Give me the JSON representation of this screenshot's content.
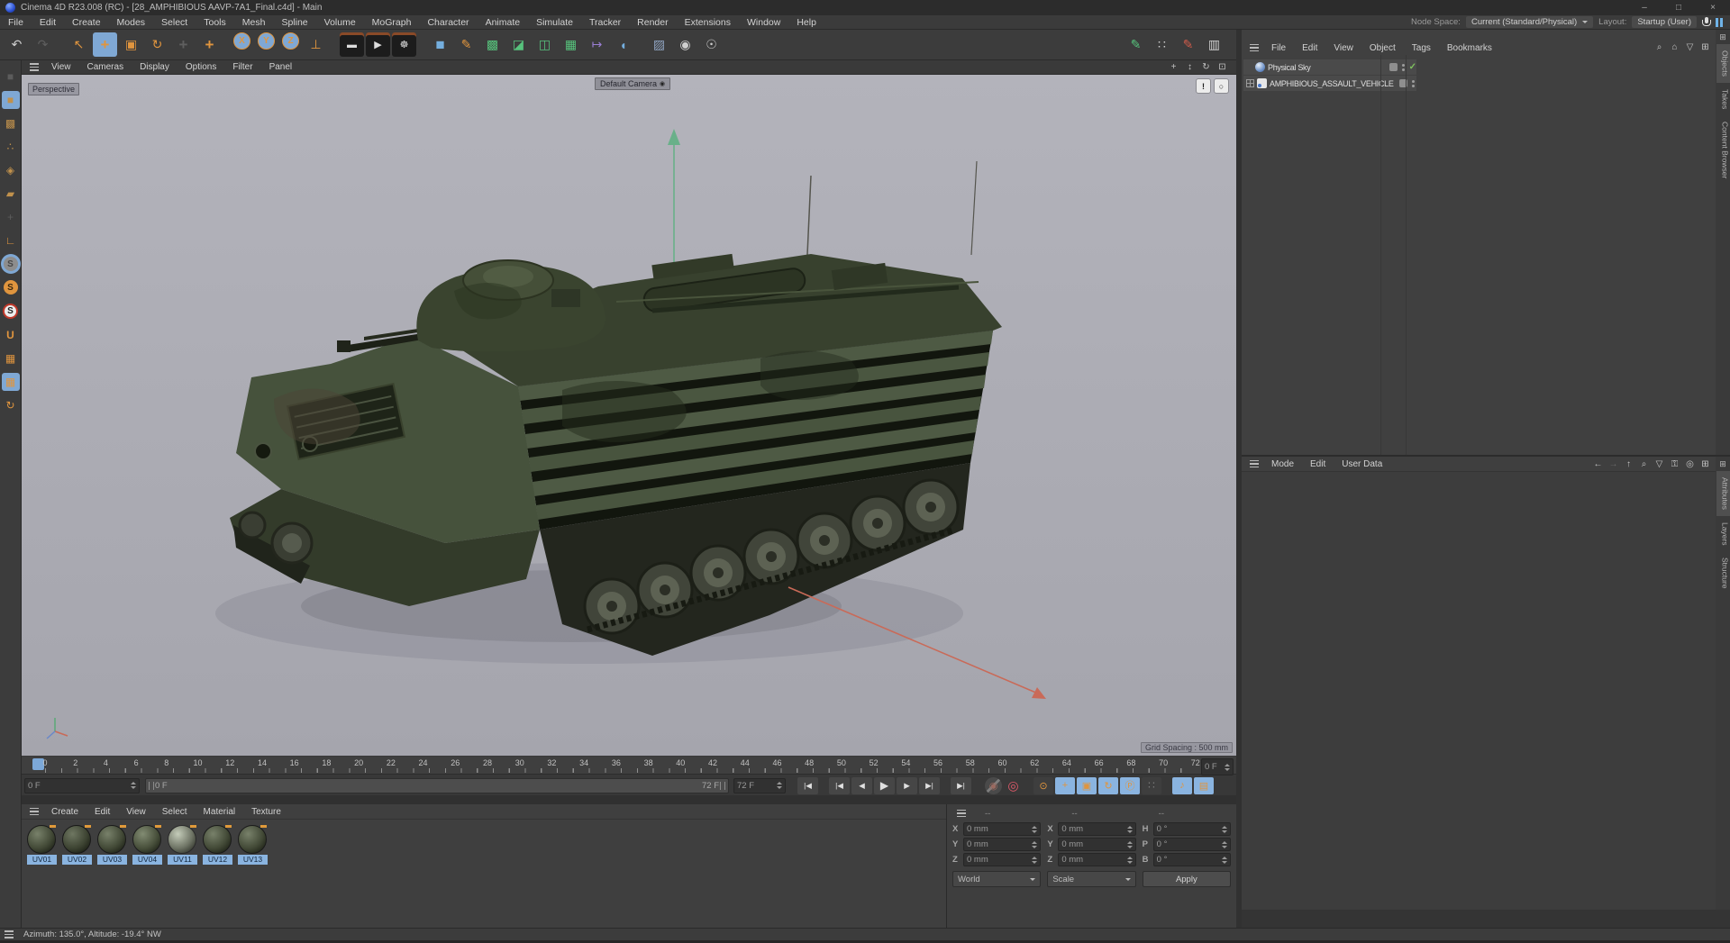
{
  "window": {
    "title": "Cinema 4D R23.008 (RC) - [28_AMPHIBIOUS AAVP-7A1_Final.c4d] - Main",
    "minimize": "–",
    "maximize": "□",
    "close": "×"
  },
  "menubar": {
    "items": [
      "File",
      "Edit",
      "Create",
      "Modes",
      "Select",
      "Tools",
      "Mesh",
      "Spline",
      "Volume",
      "MoGraph",
      "Character",
      "Animate",
      "Simulate",
      "Tracker",
      "Render",
      "Extensions",
      "Window",
      "Help"
    ],
    "node_space_label": "Node Space:",
    "node_space_value": "Current (Standard/Physical)",
    "layout_label": "Layout:",
    "layout_value": "Startup (User)"
  },
  "toolbar": {
    "main": [
      {
        "name": "undo-icon",
        "glyph": "↶",
        "cls": "light"
      },
      {
        "name": "redo-icon",
        "glyph": "↷",
        "cls": "dim"
      },
      {
        "name": "live-selection-icon",
        "glyph": "↖",
        "cls": "orange gap"
      },
      {
        "name": "move-tool-icon",
        "glyph": "+",
        "cls": "orange big active"
      },
      {
        "name": "scale-tool-icon",
        "glyph": "▣",
        "cls": "orange"
      },
      {
        "name": "rotate-tool-icon",
        "glyph": "↻",
        "cls": "orange"
      },
      {
        "name": "last-tool-icon",
        "glyph": "+",
        "cls": "dim big"
      },
      {
        "name": "tweak-move-icon",
        "glyph": "+",
        "cls": "orange big"
      },
      {
        "name": "lock-x-axis-icon",
        "glyph": "X",
        "cls": "axis active gap"
      },
      {
        "name": "lock-y-axis-icon",
        "glyph": "Y",
        "cls": "axis active"
      },
      {
        "name": "lock-z-axis-icon",
        "glyph": "Z",
        "cls": "axis active"
      },
      {
        "name": "coordinate-system-icon",
        "glyph": "⊥",
        "cls": "orange"
      },
      {
        "name": "render-view-icon",
        "glyph": "▬",
        "cls": "clap gap"
      },
      {
        "name": "render-picture-viewer-icon",
        "glyph": "▶",
        "cls": "clap"
      },
      {
        "name": "render-settings-icon",
        "glyph": "☸",
        "cls": "clap"
      },
      {
        "name": "primitive-cube-icon",
        "glyph": "■",
        "cls": "blue gap big"
      },
      {
        "name": "spline-pen-icon",
        "glyph": "✎",
        "cls": "orange"
      },
      {
        "name": "subdivision-surface-icon",
        "glyph": "▩",
        "cls": "green"
      },
      {
        "name": "boole-icon",
        "glyph": "◪",
        "cls": "green"
      },
      {
        "name": "symmetry-icon",
        "glyph": "◫",
        "cls": "green"
      },
      {
        "name": "array-icon",
        "glyph": "▦",
        "cls": "green"
      },
      {
        "name": "instance-icon",
        "glyph": "↦",
        "cls": "purple"
      },
      {
        "name": "volume-icon",
        "glyph": "◖",
        "cls": "blue"
      },
      {
        "name": "floor-icon",
        "glyph": "▨",
        "cls": "slate gap"
      },
      {
        "name": "camera-icon",
        "glyph": "◉",
        "cls": "light"
      },
      {
        "name": "light-icon",
        "glyph": "☉",
        "cls": "light"
      }
    ],
    "extra": [
      {
        "name": "paint-brush-icon",
        "glyph": "✎",
        "cls": "green"
      },
      {
        "name": "dot-grid-icon",
        "glyph": "∷",
        "cls": "light"
      },
      {
        "name": "red-pencil-icon",
        "glyph": "✎",
        "cls": "red"
      },
      {
        "name": "levels-icon",
        "glyph": "▥",
        "cls": "light"
      }
    ]
  },
  "left_toolbar": {
    "icons": [
      {
        "name": "make-editable-icon",
        "glyph": "■",
        "cls": "dim"
      },
      {
        "name": "model-mode-icon",
        "glyph": "■",
        "cls": "cube active"
      },
      {
        "name": "texture-mode-icon",
        "glyph": "▩",
        "cls": "cube"
      },
      {
        "name": "point-mode-icon",
        "glyph": "∴",
        "cls": "cube"
      },
      {
        "name": "edge-mode-icon",
        "glyph": "◈",
        "cls": "cube"
      },
      {
        "name": "polygon-mode-icon",
        "glyph": "▰",
        "cls": "cube"
      },
      {
        "name": "tweak-mode-icon",
        "glyph": "+",
        "cls": "dim"
      },
      {
        "name": "enable-axis-icon",
        "glyph": "∟",
        "cls": "orange bold"
      },
      {
        "name": "solo-off-icon",
        "glyph": "S",
        "cls": "solo gray active"
      },
      {
        "name": "solo-single-icon",
        "glyph": "S",
        "cls": "solo amber"
      },
      {
        "name": "solo-hierarchy-icon",
        "glyph": "S",
        "cls": "solo ring"
      },
      {
        "name": "snap-icon",
        "glyph": "U",
        "cls": "orange bold"
      },
      {
        "name": "workplane-icon",
        "glyph": "▦",
        "cls": "orange"
      },
      {
        "name": "lock-workplane-icon",
        "glyph": "▦",
        "cls": "orange active"
      },
      {
        "name": "workplane-rotate-icon",
        "glyph": "↻",
        "cls": "orange"
      }
    ]
  },
  "viewport": {
    "menu": [
      "View",
      "Cameras",
      "Display",
      "Options",
      "Filter",
      "Panel"
    ],
    "nav_icons": [
      {
        "name": "pan-view-icon",
        "glyph": "+"
      },
      {
        "name": "dolly-view-icon",
        "glyph": "↕"
      },
      {
        "name": "orbit-view-icon",
        "glyph": "↻"
      },
      {
        "name": "toggle-panel-icon",
        "glyph": "⊡"
      }
    ],
    "hud_icons": [
      {
        "name": "viewport-mic-icon",
        "glyph": "!"
      },
      {
        "name": "viewport-ring-icon",
        "glyph": "○"
      }
    ],
    "view_label": "Perspective",
    "camera_label": "Default Camera",
    "grid_spacing": "Grid Spacing : 500 mm"
  },
  "object_manager": {
    "menu": [
      "File",
      "Edit",
      "View",
      "Object",
      "Tags",
      "Bookmarks"
    ],
    "actions": [
      {
        "name": "om-search-icon",
        "glyph": "⌕"
      },
      {
        "name": "om-home-icon",
        "glyph": "⌂"
      },
      {
        "name": "om-filter-icon",
        "glyph": "▽"
      },
      {
        "name": "om-add-icon",
        "glyph": "⊞"
      }
    ],
    "tabs": [
      "Objects",
      "Takes",
      "Content Browser"
    ],
    "rows": [
      {
        "name": "Physical Sky"
      },
      {
        "name": "AMPHIBIOUS_ASSAULT_VEHICLE"
      }
    ]
  },
  "attribute_manager": {
    "menu": [
      "Mode",
      "Edit",
      "User Data"
    ],
    "actions": [
      {
        "name": "am-back-icon",
        "glyph": "←"
      },
      {
        "name": "am-forward-icon",
        "glyph": "→",
        "cls": "dim"
      },
      {
        "name": "am-up-icon",
        "glyph": "↑"
      },
      {
        "name": "am-search-icon",
        "glyph": "⌕"
      },
      {
        "name": "am-filter-icon",
        "glyph": "▽"
      },
      {
        "name": "am-lock-icon",
        "glyph": "⚿"
      },
      {
        "name": "am-target-icon",
        "glyph": "◎"
      },
      {
        "name": "am-add-icon",
        "glyph": "⊞"
      }
    ],
    "tabs": [
      "Attributes",
      "Layers",
      "Structure"
    ]
  },
  "timeline": {
    "ticks": [
      "0",
      "2",
      "4",
      "6",
      "8",
      "10",
      "12",
      "14",
      "16",
      "18",
      "20",
      "22",
      "24",
      "26",
      "28",
      "30",
      "32",
      "34",
      "36",
      "38",
      "40",
      "42",
      "44",
      "46",
      "48",
      "50",
      "52",
      "54",
      "56",
      "58",
      "60",
      "62",
      "64",
      "66",
      "68",
      "70",
      "72"
    ],
    "current_frame": "0 F",
    "start_frame": "0 F",
    "range_start": "0 F",
    "range_end": "72 F",
    "end_frame": "72 F",
    "transport": [
      {
        "name": "goto-start-button",
        "glyph": "|◀"
      },
      {
        "name": "previous-key-button",
        "glyph": "|◀",
        "cls": "gapL"
      },
      {
        "name": "previous-frame-button",
        "glyph": "◀"
      },
      {
        "name": "play-button",
        "glyph": "▶",
        "cls": "play"
      },
      {
        "name": "next-frame-button",
        "glyph": "▶"
      },
      {
        "name": "next-key-button",
        "glyph": "▶|"
      },
      {
        "name": "goto-end-button",
        "glyph": "▶|",
        "cls": "gapL"
      }
    ],
    "record": [
      {
        "name": "record-keyframe-button",
        "glyph": "◉",
        "cls": "recoff"
      },
      {
        "name": "autokey-button",
        "glyph": "◎",
        "cls": "rec"
      }
    ],
    "key_toggles": [
      {
        "name": "keyframe-selection-icon",
        "glyph": "⊙"
      },
      {
        "name": "key-position-toggle",
        "glyph": "+",
        "cls": "active"
      },
      {
        "name": "key-scale-toggle",
        "glyph": "▣",
        "cls": "active"
      },
      {
        "name": "key-rotation-toggle",
        "glyph": "↻",
        "cls": "active"
      },
      {
        "name": "key-parameter-toggle",
        "glyph": "Ⓟ",
        "cls": "active"
      },
      {
        "name": "key-pla-toggle",
        "glyph": "∷",
        "cls": "dimtog"
      }
    ],
    "playback": [
      {
        "name": "sound-toggle",
        "glyph": "♪",
        "cls": "active"
      },
      {
        "name": "playback-mode-toggle",
        "glyph": "▤",
        "cls": "active"
      }
    ]
  },
  "materials": {
    "menu": [
      "Create",
      "Edit",
      "View",
      "Select",
      "Material",
      "Texture"
    ],
    "items": [
      "UV01",
      "UV02",
      "UV03",
      "UV04",
      "UV11",
      "UV12",
      "UV13"
    ]
  },
  "coordinates": {
    "headers": [
      "--",
      "--",
      "--"
    ],
    "fields": [
      {
        "label": "X",
        "value": "0 mm"
      },
      {
        "label": "X",
        "value": "0 mm"
      },
      {
        "label": "H",
        "value": "0 °"
      },
      {
        "label": "Y",
        "value": "0 mm"
      },
      {
        "label": "Y",
        "value": "0 mm"
      },
      {
        "label": "P",
        "value": "0 °"
      },
      {
        "label": "Z",
        "value": "0 mm"
      },
      {
        "label": "Z",
        "value": "0 mm"
      },
      {
        "label": "B",
        "value": "0 °"
      }
    ],
    "world_dropdown": "World",
    "scale_dropdown": "Scale",
    "apply_label": "Apply"
  },
  "statusbar": {
    "text": "Azimuth: 135.0°, Altitude: -19.4°  NW"
  }
}
